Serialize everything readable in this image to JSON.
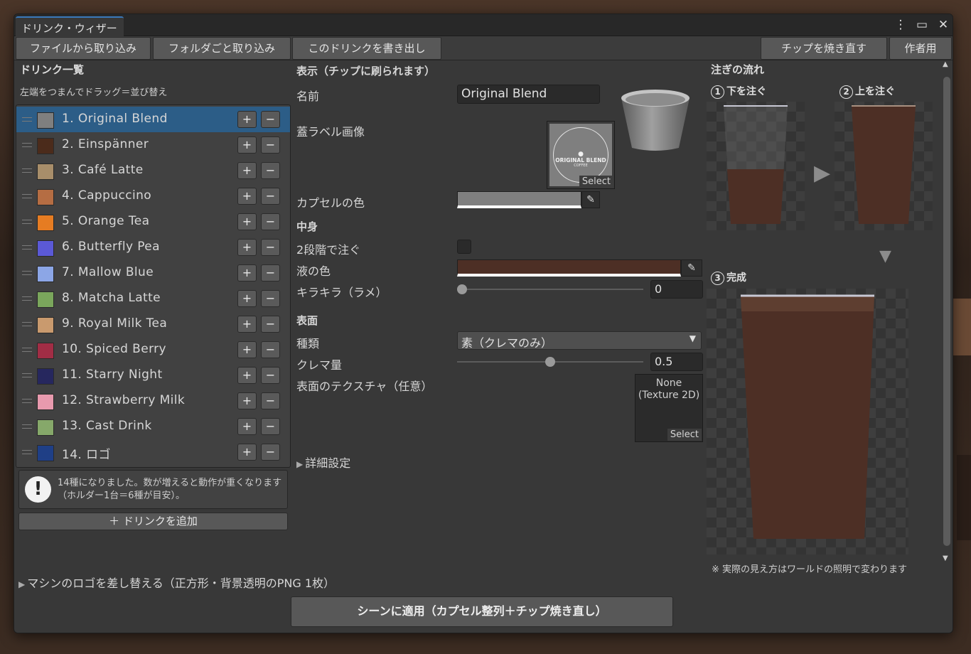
{
  "window": {
    "title": "ドリンク・ウィザード"
  },
  "toolbar": {
    "import_file": "ファイルから取り込み",
    "import_folder": "フォルダごと取り込み",
    "export_drink": "このドリンクを書き出し",
    "rebake_chips": "チップを焼き直す",
    "author_only": "作者用"
  },
  "list": {
    "title": "ドリンク一覧",
    "hint": "左端をつまんでドラッグ＝並び替え",
    "items": [
      {
        "label": "1.  Original Blend",
        "color": "#7f7f7f",
        "selected": true
      },
      {
        "label": "2.  Einspänner",
        "color": "#4b2b1b"
      },
      {
        "label": "3.  Café Latte",
        "color": "#a88e6a"
      },
      {
        "label": "4.  Cappuccino",
        "color": "#b56d43"
      },
      {
        "label": "5.  Orange Tea",
        "color": "#e67c22"
      },
      {
        "label": "6.  Butterfly Pea",
        "color": "#5b59d6"
      },
      {
        "label": "7.  Mallow Blue",
        "color": "#8ca6e6"
      },
      {
        "label": "8.  Matcha Latte",
        "color": "#7aa65c"
      },
      {
        "label": "9.  Royal Milk Tea",
        "color": "#c99a6e"
      },
      {
        "label": "10.  Spiced Berry",
        "color": "#a12d45"
      },
      {
        "label": "11.  Starry Night",
        "color": "#26275e"
      },
      {
        "label": "12.  Strawberry Milk",
        "color": "#e89aae"
      },
      {
        "label": "13.  Cast Drink",
        "color": "#86a86a"
      },
      {
        "label": "14.  ロゴ",
        "color": "#1f3f86"
      }
    ],
    "plus": "+",
    "minus": "−",
    "warning": "14種になりました。数が増えると動作が重くなります（ホルダー1台＝6種が目安）。",
    "add_drink": "＋ ドリンクを追加"
  },
  "display": {
    "title": "表示（チップに刷られます）",
    "name_label": "名前",
    "name_value": "Original Blend",
    "lid_label": "蓋ラベル画像",
    "lid_logo_line1": "ORIGINAL BLEND",
    "lid_logo_line2": "COFFEE",
    "select": "Select",
    "capsule_color_label": "カプセルの色",
    "capsule_color": "#7f7f7f"
  },
  "contents": {
    "title": "中身",
    "two_stage_label": "2段階で注ぐ",
    "two_stage": false,
    "liquid_color_label": "液の色",
    "liquid_color": "#4d2f25",
    "glitter_label": "キラキラ（ラメ）",
    "glitter_value": "0",
    "glitter_fraction": 0
  },
  "surface": {
    "title": "表面",
    "type_label": "種類",
    "type_value": "素（クレマのみ）",
    "crema_label": "クレマ量",
    "crema_value": "0.5",
    "crema_fraction": 0.5,
    "texture_label": "表面のテクスチャ（任意）",
    "texture_value": "None\n(Texture 2D)",
    "select": "Select"
  },
  "advanced": {
    "label": "詳細設定"
  },
  "pour": {
    "title": "注ぎの流れ",
    "step1": "下を注ぐ",
    "step2": "上を注ぐ",
    "step3": "完成",
    "n1": "1",
    "n2": "2",
    "n3": "3",
    "note": "※ 実際の見え方はワールドの照明で変わります"
  },
  "footer": {
    "logo_replace": "マシンのロゴを差し替える（正方形・背景透明のPNG 1枚）",
    "apply": "シーンに適用（カプセル整列＋チップ焼き直し）"
  }
}
